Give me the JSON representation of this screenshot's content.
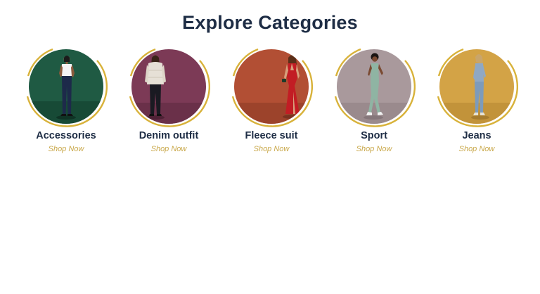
{
  "section": {
    "title": "Explore Categories"
  },
  "categories": [
    {
      "label": "Accessories",
      "link": "Shop Now",
      "bg": "#1f5a43",
      "floor": "#174a36",
      "outfit": "denim-white-tee"
    },
    {
      "label": "Denim outfit",
      "link": "Shop Now",
      "bg": "#7c3a56",
      "floor": "#6a3049",
      "outfit": "puffer-jacket"
    },
    {
      "label": "Fleece suit",
      "link": "Shop Now",
      "bg": "#b24f34",
      "floor": "#9c432b",
      "outfit": "red-gown"
    },
    {
      "label": "Sport",
      "link": "Shop Now",
      "bg": "#a9999c",
      "floor": "#9a8a8d",
      "outfit": "sage-activewear"
    },
    {
      "label": "Jeans",
      "link": "Shop Now",
      "bg": "#d3a346",
      "floor": "#c2933a",
      "outfit": "blue-denim"
    }
  ],
  "colors": {
    "title": "#1e2d45",
    "accent_gold": "#c9a84a",
    "ring_gold": "#d8b23a"
  }
}
